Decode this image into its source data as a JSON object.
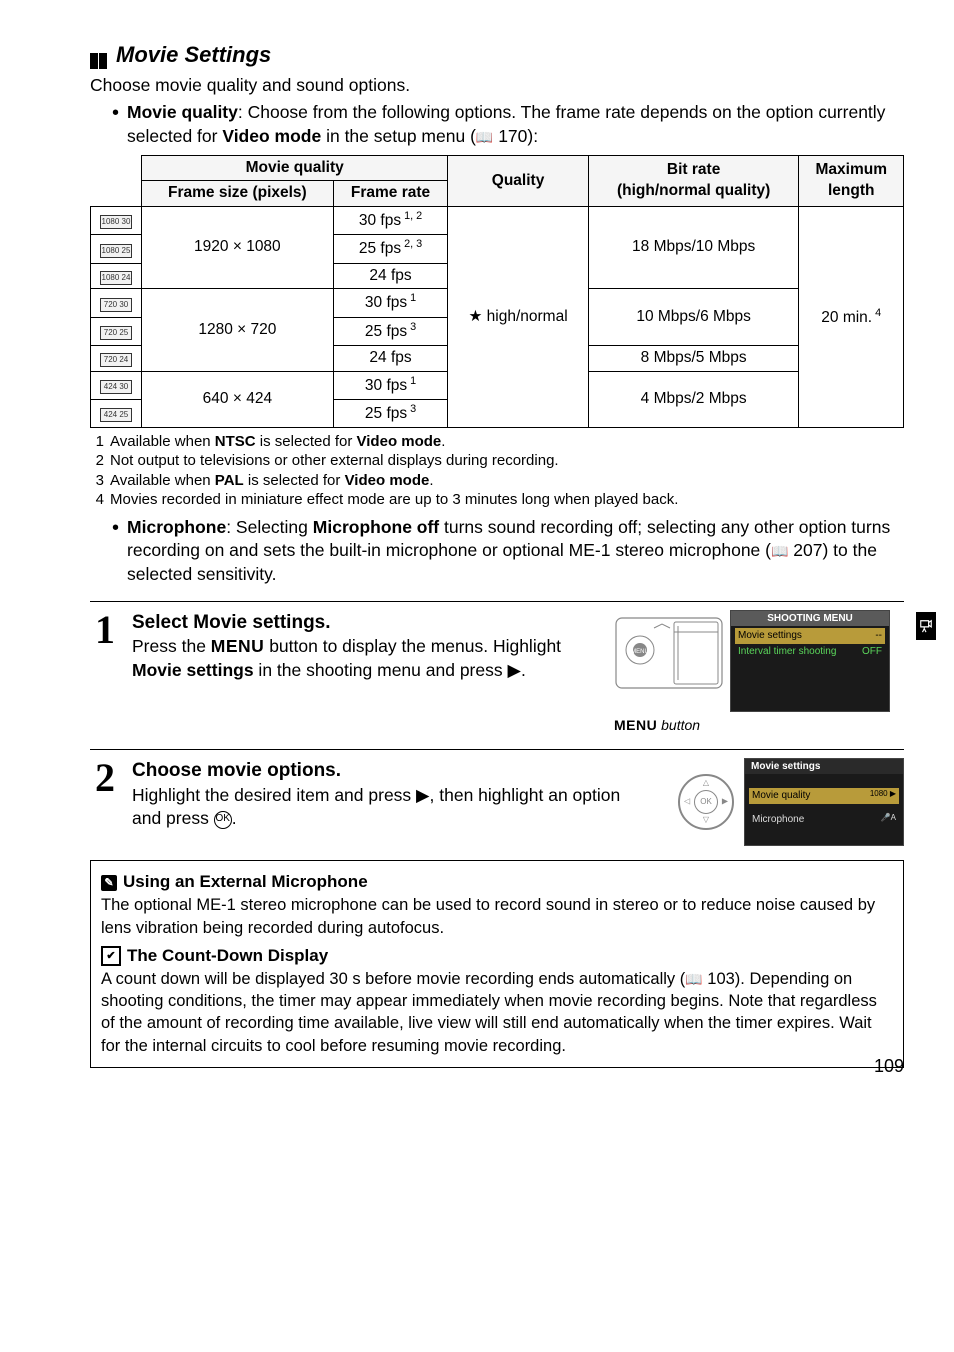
{
  "section_title": "Movie Settings",
  "intro": "Choose movie quality and sound options.",
  "bullet1_label": "Movie quality",
  "bullet1_rest": ": Choose from the following options.  The frame rate depends on the option currently selected for ",
  "bullet1_bold2": "Video mode",
  "bullet1_tail": " in the setup menu (",
  "bullet1_pageref": "170):",
  "table": {
    "h_mq": "Movie quality",
    "h_frame_size": "Frame size (pixels)",
    "h_frame_rate": "Frame rate",
    "h_quality": "Quality",
    "h_bitrate": "Bit rate\n(high/normal quality)",
    "h_maxlen": "Maximum\nlength",
    "fs_1080": "1920 × 1080",
    "fs_720": "1280 ×   720",
    "fs_424": "640 ×   424",
    "fr_30_12": "30 fps 1, 2",
    "fr_25_23": "25 fps 2, 3",
    "fr_24": "24 fps",
    "fr_30_1": "30 fps 1",
    "fr_25_3": "25 fps 3",
    "quality_val": "★ high/normal",
    "br_1080": "18 Mbps/10 Mbps",
    "br_720a": "10 Mbps/6 Mbps",
    "br_720b": "8 Mbps/5 Mbps",
    "br_424": "4 Mbps/2 Mbps",
    "maxlen_val": "20 min. 4"
  },
  "footnotes": {
    "f1a": "Available when ",
    "f1b": "NTSC",
    "f1c": " is selected for ",
    "f1d": "Video mode",
    "f1e": ".",
    "f2": "Not output to televisions or other external displays during recording.",
    "f3a": "Available when ",
    "f3b": "PAL",
    "f3c": " is selected for ",
    "f3d": "Video mode",
    "f3e": ".",
    "f4": "Movies recorded in miniature effect mode are up to 3 minutes long when played back."
  },
  "bullet2_label": "Microphone",
  "bullet2_a": ": Selecting ",
  "bullet2_b": "Microphone off",
  "bullet2_c": " turns sound recording off; selecting any other option turns recording on and sets the built-in microphone or optional ME-1 stereo microphone (",
  "bullet2_pageref": "207) to the selected sensitivity.",
  "step1": {
    "title_a": "Select ",
    "title_b": "Movie settings",
    "title_c": ".",
    "body_a": "Press the ",
    "body_menu": "MENU",
    "body_b": " button to display the menus. Highlight ",
    "body_c": "Movie settings",
    "body_d": " in the shooting menu and press ",
    "body_e": ".",
    "caption_a": "MENU",
    "caption_b": " button",
    "lcd_title": "SHOOTING MENU",
    "lcd_row1": "Movie settings",
    "lcd_row1_val": "--",
    "lcd_row2": "Interval timer shooting",
    "lcd_row2_val": "OFF"
  },
  "step2": {
    "title": "Choose movie options.",
    "body_a": "Highlight the desired item and press ",
    "body_b": ", then highlight an option and press ",
    "body_c": ".",
    "lcd_title": "Movie settings",
    "lcd_row1": "Movie quality",
    "lcd_row2": "Microphone"
  },
  "info1": {
    "title": "Using an External Microphone",
    "body": "The optional ME-1 stereo microphone can be used to record sound in stereo or to reduce noise caused by lens vibration being recorded during autofocus."
  },
  "info2": {
    "title": "The Count-Down Display",
    "body_a": "A count down will be displayed 30 s before movie recording ends automatically (",
    "body_pageref": "103). Depending on shooting conditions, the timer may appear immediately when movie recording begins.  Note that regardless of the amount of recording time available, live view will still end automatically when the timer expires.  Wait for the internal circuits to cool before resuming movie recording."
  },
  "page_number": "109",
  "chart_data": {
    "type": "table",
    "title": "Movie quality options",
    "columns": [
      "Frame size (pixels)",
      "Frame rate",
      "Quality",
      "Bit rate (high/normal quality)",
      "Maximum length"
    ],
    "rows": [
      {
        "frame_size": "1920 × 1080",
        "frame_rate": "30 fps",
        "fr_notes": [
          1,
          2
        ],
        "quality": "high/normal",
        "bitrate": "18 Mbps/10 Mbps",
        "max_length": "20 min.",
        "ml_notes": [
          4
        ]
      },
      {
        "frame_size": "1920 × 1080",
        "frame_rate": "25 fps",
        "fr_notes": [
          2,
          3
        ],
        "quality": "high/normal",
        "bitrate": "18 Mbps/10 Mbps",
        "max_length": "20 min.",
        "ml_notes": [
          4
        ]
      },
      {
        "frame_size": "1920 × 1080",
        "frame_rate": "24 fps",
        "fr_notes": [],
        "quality": "high/normal",
        "bitrate": "18 Mbps/10 Mbps",
        "max_length": "20 min.",
        "ml_notes": [
          4
        ]
      },
      {
        "frame_size": "1280 × 720",
        "frame_rate": "30 fps",
        "fr_notes": [
          1
        ],
        "quality": "high/normal",
        "bitrate": "10 Mbps/6 Mbps",
        "max_length": "20 min.",
        "ml_notes": [
          4
        ]
      },
      {
        "frame_size": "1280 × 720",
        "frame_rate": "25 fps",
        "fr_notes": [
          3
        ],
        "quality": "high/normal",
        "bitrate": "10 Mbps/6 Mbps",
        "max_length": "20 min.",
        "ml_notes": [
          4
        ]
      },
      {
        "frame_size": "1280 × 720",
        "frame_rate": "24 fps",
        "fr_notes": [],
        "quality": "high/normal",
        "bitrate": "8 Mbps/5 Mbps",
        "max_length": "20 min.",
        "ml_notes": [
          4
        ]
      },
      {
        "frame_size": "640 × 424",
        "frame_rate": "30 fps",
        "fr_notes": [
          1
        ],
        "quality": "high/normal",
        "bitrate": "4 Mbps/2 Mbps",
        "max_length": "20 min.",
        "ml_notes": [
          4
        ]
      },
      {
        "frame_size": "640 × 424",
        "frame_rate": "25 fps",
        "fr_notes": [
          3
        ],
        "quality": "high/normal",
        "bitrate": "4 Mbps/2 Mbps",
        "max_length": "20 min.",
        "ml_notes": [
          4
        ]
      }
    ],
    "footnotes": {
      "1": "Available when NTSC is selected for Video mode.",
      "2": "Not output to televisions or other external displays during recording.",
      "3": "Available when PAL is selected for Video mode.",
      "4": "Movies recorded in miniature effect mode are up to 3 minutes long when played back."
    }
  }
}
